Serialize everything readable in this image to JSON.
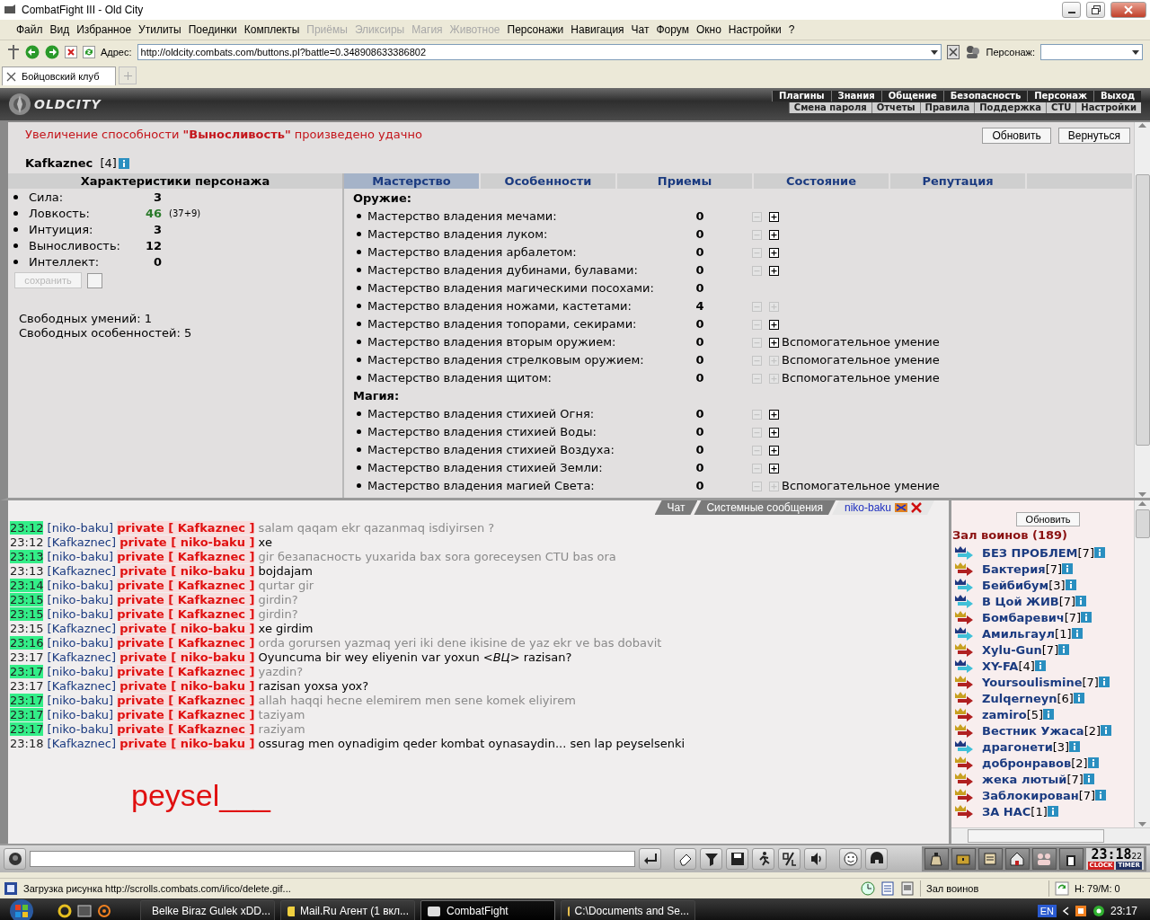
{
  "window": {
    "title": "CombatFight III - Old City"
  },
  "menu": [
    {
      "label": "Файл",
      "disabled": false
    },
    {
      "label": "Вид",
      "disabled": false
    },
    {
      "label": "Избранное",
      "disabled": false
    },
    {
      "label": "Утилиты",
      "disabled": false
    },
    {
      "label": "Поединки",
      "disabled": false
    },
    {
      "label": "Комплекты",
      "disabled": false
    },
    {
      "label": "Приёмы",
      "disabled": true
    },
    {
      "label": "Эликсиры",
      "disabled": true
    },
    {
      "label": "Магия",
      "disabled": true
    },
    {
      "label": "Животное",
      "disabled": true
    },
    {
      "label": "Персонажи",
      "disabled": false
    },
    {
      "label": "Навигация",
      "disabled": false
    },
    {
      "label": "Чат",
      "disabled": false
    },
    {
      "label": "Форум",
      "disabled": false
    },
    {
      "label": "Окно",
      "disabled": false
    },
    {
      "label": "Настройки",
      "disabled": false
    },
    {
      "label": "?",
      "disabled": false
    }
  ],
  "address": {
    "label": "Адрес:",
    "url": "http://oldcity.combats.com/buttons.pl?battle=0.348908633386802",
    "character_label": "Персонаж:"
  },
  "browser_tabs": [
    {
      "label": "Бойцовский клуб",
      "selected": true
    }
  ],
  "game_nav": {
    "logo": "OLDCITY",
    "primary": [
      "Плагины",
      "Знания",
      "Общение",
      "Безопасность",
      "Персонаж",
      "Выход"
    ],
    "secondary": [
      "Смена пароля",
      "Отчеты",
      "Правила",
      "Поддержка",
      "CTU",
      "Настройки"
    ]
  },
  "notice": "Увеличение способности **\"Выносливость\"** произведено удачно",
  "actions": [
    "Обновить",
    "Вернуться"
  ],
  "character": {
    "name": "Kafkaznec",
    "level": "[4]"
  },
  "stats": {
    "title": "Характеристики персонажа",
    "items": [
      {
        "label": "Сила:",
        "value": "3",
        "modified": false
      },
      {
        "label": "Ловкость:",
        "value": "46",
        "bonus": "(37+9)",
        "modified": true
      },
      {
        "label": "Интуиция:",
        "value": "3",
        "modified": false
      },
      {
        "label": "Выносливость:",
        "value": "12",
        "modified": false
      },
      {
        "label": "Интеллект:",
        "value": "0",
        "modified": false
      }
    ],
    "save_button": {
      "label": "сохранить",
      "disabled": true
    },
    "confirm_checked": false,
    "free": [
      "Свободных умений: 1",
      "Свободных особенностей: 5"
    ]
  },
  "skill_tabs": [
    {
      "label": "Мастерство",
      "selected": true
    },
    {
      "label": "Особенности",
      "selected": false
    },
    {
      "label": "Приемы",
      "selected": false
    },
    {
      "label": "Состояние",
      "selected": false
    },
    {
      "label": "Репутация",
      "selected": false
    }
  ],
  "skill_groups": [
    {
      "title": "Оружие:",
      "skills": [
        {
          "name": "Мастерство владения мечами:",
          "value": "0",
          "controls": true,
          "plus_enabled": true
        },
        {
          "name": "Мастерство владения луком:",
          "value": "0",
          "controls": true,
          "plus_enabled": true
        },
        {
          "name": "Мастерство владения арбалетом:",
          "value": "0",
          "controls": true,
          "plus_enabled": true
        },
        {
          "name": "Мастерство владения дубинами, булавами:",
          "value": "0",
          "controls": true,
          "plus_enabled": true
        },
        {
          "name": "Мастерство владения магическими посохами:",
          "value": "0",
          "controls": false
        },
        {
          "name": "Мастерство владения ножами, кастетами:",
          "value": "4",
          "controls": true,
          "plus_enabled": false
        },
        {
          "name": "Мастерство владения топорами, секирами:",
          "value": "0",
          "controls": true,
          "plus_enabled": true
        },
        {
          "name": "Мастерство владения вторым оружием:",
          "value": "0",
          "controls": true,
          "plus_enabled": true,
          "note": "Вспомогательное умение"
        },
        {
          "name": "Мастерство владения стрелковым оружием:",
          "value": "0",
          "controls": true,
          "plus_enabled": false,
          "note": "Вспомогательное умение"
        },
        {
          "name": "Мастерство владения щитом:",
          "value": "0",
          "controls": true,
          "plus_enabled": false,
          "note": "Вспомогательное умение"
        }
      ]
    },
    {
      "title": "Магия:",
      "skills": [
        {
          "name": "Мастерство владения стихией Огня:",
          "value": "0",
          "controls": true,
          "plus_enabled": true
        },
        {
          "name": "Мастерство владения стихией Воды:",
          "value": "0",
          "controls": true,
          "plus_enabled": true
        },
        {
          "name": "Мастерство владения стихией Воздуха:",
          "value": "0",
          "controls": true,
          "plus_enabled": true
        },
        {
          "name": "Мастерство владения стихией Земли:",
          "value": "0",
          "controls": true,
          "plus_enabled": true
        },
        {
          "name": "Мастерство владения магией Света:",
          "value": "0",
          "controls": true,
          "plus_enabled": false,
          "note": "Вспомогательное умение"
        }
      ]
    }
  ],
  "chat_tabs": [
    {
      "label": "Чат",
      "selected": false
    },
    {
      "label": "Системные сообщения",
      "selected": false
    },
    {
      "label": "niko-baku",
      "selected": true
    }
  ],
  "chat": [
    {
      "time": "23:12",
      "incoming": true,
      "from": "[niko-baku]",
      "to": "private [ Kafkaznec ]",
      "text": "salam qaqam ekr qazanmaq isdiyirsen ?"
    },
    {
      "time": "23:12",
      "incoming": false,
      "from": "[Kafkaznec]",
      "to": "private [ niko-baku ]",
      "text": "xe"
    },
    {
      "time": "23:13",
      "incoming": true,
      "from": "[niko-baku]",
      "to": "private [ Kafkaznec ]",
      "text": "gir безапасность yuxarida bax sora goreceysen CTU bas ora"
    },
    {
      "time": "23:13",
      "incoming": false,
      "from": "[Kafkaznec]",
      "to": "private [ niko-baku ]",
      "text": "bojdajam"
    },
    {
      "time": "23:14",
      "incoming": true,
      "from": "[niko-baku]",
      "to": "private [ Kafkaznec ]",
      "text": "qurtar gir"
    },
    {
      "time": "23:15",
      "incoming": true,
      "from": "[niko-baku]",
      "to": "private [ Kafkaznec ]",
      "text": "girdin?"
    },
    {
      "time": "23:15",
      "incoming": true,
      "from": "[niko-baku]",
      "to": "private [ Kafkaznec ]",
      "text": "girdin?"
    },
    {
      "time": "23:15",
      "incoming": false,
      "from": "[Kafkaznec]",
      "to": "private [ niko-baku ]",
      "text": "xe girdim"
    },
    {
      "time": "23:16",
      "incoming": true,
      "from": "[niko-baku]",
      "to": "private [ Kafkaznec ]",
      "text": "orda gorursen yazmaq yeri iki dene ikisine de yaz ekr ve bas dobavit"
    },
    {
      "time": "23:17",
      "incoming": false,
      "from": "[Kafkaznec]",
      "to": "private [ niko-baku ]",
      "text": "Oyuncuma bir wey eliyenin var yoxun *<ВЦ>* razisan?"
    },
    {
      "time": "23:17",
      "incoming": true,
      "from": "[niko-baku]",
      "to": "private [ Kafkaznec ]",
      "text": "yazdin?"
    },
    {
      "time": "23:17",
      "incoming": false,
      "from": "[Kafkaznec]",
      "to": "private [ niko-baku ]",
      "text": "razisan yoxsa yox?"
    },
    {
      "time": "23:17",
      "incoming": true,
      "from": "[niko-baku]",
      "to": "private [ Kafkaznec ]",
      "text": "allah haqqi hecne elemirem men sene komek eliyirem"
    },
    {
      "time": "23:17",
      "incoming": true,
      "from": "[niko-baku]",
      "to": "private [ Kafkaznec ]",
      "text": "taziyam"
    },
    {
      "time": "23:17",
      "incoming": true,
      "from": "[niko-baku]",
      "to": "private [ Kafkaznec ]",
      "text": "raziyam"
    },
    {
      "time": "23:18",
      "incoming": false,
      "from": "[Kafkaznec]",
      "to": "private [ niko-baku ]",
      "text": "ossurag men oynadigim qeder kombat oynasaydin... sen lap peyselsenki"
    }
  ],
  "scribble": "peysel___",
  "room": {
    "refresh": "Обновить",
    "title": "Зал воинов (189)",
    "users": [
      {
        "name": "БЕЗ ПРОБЛЕМ",
        "level": "[7]",
        "kind": "blue"
      },
      {
        "name": "Бактерия",
        "level": "[7]",
        "kind": "red"
      },
      {
        "name": "Бейбибум",
        "level": "[3]",
        "kind": "blue"
      },
      {
        "name": "В Цой ЖИВ",
        "level": "[7]",
        "kind": "blue"
      },
      {
        "name": "Бомбаревич",
        "level": "[7]",
        "kind": "red"
      },
      {
        "name": "Амильгаул",
        "level": "[1]",
        "kind": "blue"
      },
      {
        "name": "Xylu-Gun",
        "level": "[7]",
        "kind": "red"
      },
      {
        "name": "XY-FA",
        "level": "[4]",
        "kind": "blue"
      },
      {
        "name": "Yoursoulismine",
        "level": "[7]",
        "kind": "red"
      },
      {
        "name": "Zulqerneyn",
        "level": "[6]",
        "kind": "red"
      },
      {
        "name": "zamiro",
        "level": "[5]",
        "kind": "red"
      },
      {
        "name": "Вестник Ужаса",
        "level": "[2]",
        "kind": "red"
      },
      {
        "name": "драгонети",
        "level": "[3]",
        "kind": "blue"
      },
      {
        "name": "добронравов",
        "level": "[2]",
        "kind": "red"
      },
      {
        "name": "жека лютый",
        "level": "[7]",
        "kind": "red"
      },
      {
        "name": "Заблокирован",
        "level": "[7]",
        "kind": "red"
      },
      {
        "name": "ЗА НАС",
        "level": "[1]",
        "kind": "red"
      }
    ]
  },
  "clock": {
    "time": "23:18",
    "seconds": "22",
    "clock_label": "CLOCK",
    "timer_label": "TIMER"
  },
  "status_bar": {
    "text": "Загрузка рисунка http://scrolls.combats.com/i/ico/delete.gif...",
    "location": "Зал воинов",
    "health": "H: 79/M: 0"
  },
  "taskbar": {
    "tasks": [
      {
        "label": "Belke Biraz Gulek xDD...",
        "selected": false
      },
      {
        "label": "Mail.Ru Агент (1 вкл...",
        "selected": false
      },
      {
        "label": "CombatFight",
        "selected": true
      },
      {
        "label": "C:\\Documents and Se...",
        "selected": false
      }
    ],
    "language": "EN",
    "time": "23:17"
  }
}
